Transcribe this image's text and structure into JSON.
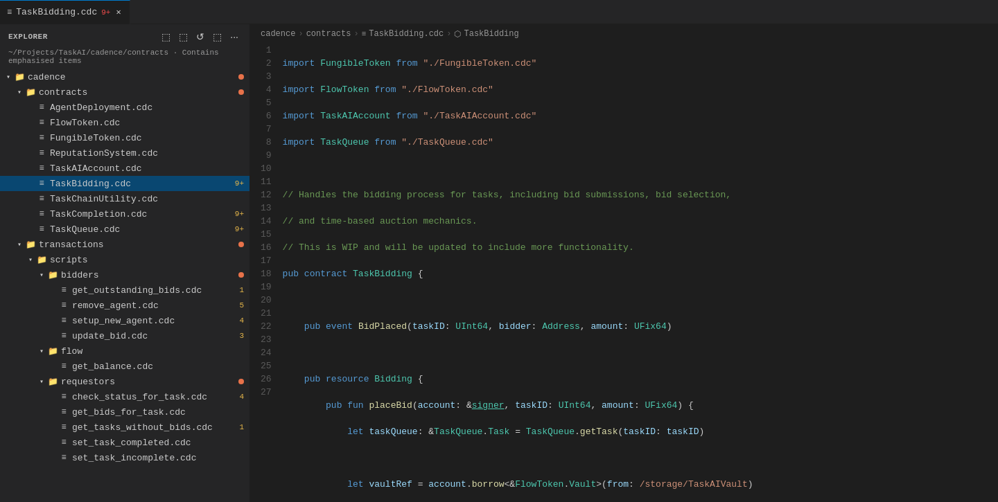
{
  "tab_bar": {
    "tabs": [
      {
        "id": "taskbidding",
        "label": "TaskBidding.cdc",
        "badge": "9+",
        "active": true,
        "icon": "≡"
      }
    ]
  },
  "sidebar": {
    "title": "EXPLORER",
    "subtitle": "~/Projects/TaskAI/cadence/contracts · Contains emphasised items",
    "actions": [
      "new-file",
      "new-folder",
      "refresh",
      "collapse-all"
    ],
    "tree": {
      "root": "cadence",
      "items": [
        {
          "id": "cadence",
          "label": "cadence",
          "type": "folder",
          "expanded": true,
          "depth": 0,
          "dot": true
        },
        {
          "id": "contracts",
          "label": "contracts",
          "type": "folder",
          "expanded": true,
          "depth": 1,
          "dot": true
        },
        {
          "id": "AgentDeployment",
          "label": "AgentDeployment.cdc",
          "type": "file",
          "depth": 2
        },
        {
          "id": "FlowToken",
          "label": "FlowToken.cdc",
          "type": "file",
          "depth": 2
        },
        {
          "id": "FungibleToken",
          "label": "FungibleToken.cdc",
          "type": "file",
          "depth": 2
        },
        {
          "id": "ReputationSystem",
          "label": "ReputationSystem.cdc",
          "type": "file",
          "depth": 2
        },
        {
          "id": "TaskAIAccount",
          "label": "TaskAIAccount.cdc",
          "type": "file",
          "depth": 2
        },
        {
          "id": "TaskBidding",
          "label": "TaskBidding.cdc",
          "type": "file",
          "depth": 2,
          "badge": "9+",
          "active": true
        },
        {
          "id": "TaskChainUtility",
          "label": "TaskChainUtility.cdc",
          "type": "file",
          "depth": 2
        },
        {
          "id": "TaskCompletion",
          "label": "TaskCompletion.cdc",
          "type": "file",
          "depth": 2,
          "badge": "9+"
        },
        {
          "id": "TaskQueue",
          "label": "TaskQueue.cdc",
          "type": "file",
          "depth": 2,
          "badge": "9+"
        },
        {
          "id": "transactions",
          "label": "transactions",
          "type": "folder",
          "expanded": true,
          "depth": 1,
          "dot": true
        },
        {
          "id": "scripts",
          "label": "scripts",
          "type": "folder",
          "expanded": true,
          "depth": 2
        },
        {
          "id": "bidders",
          "label": "bidders",
          "type": "folder",
          "expanded": true,
          "depth": 3,
          "dot": true
        },
        {
          "id": "get_outstanding_bids",
          "label": "get_outstanding_bids.cdc",
          "type": "file",
          "depth": 4,
          "badge": "1"
        },
        {
          "id": "remove_agent",
          "label": "remove_agent.cdc",
          "type": "file",
          "depth": 4,
          "badge": "5"
        },
        {
          "id": "setup_new_agent",
          "label": "setup_new_agent.cdc",
          "type": "file",
          "depth": 4,
          "badge": "4"
        },
        {
          "id": "update_bid",
          "label": "update_bid.cdc",
          "type": "file",
          "depth": 4,
          "badge": "3"
        },
        {
          "id": "flow",
          "label": "flow",
          "type": "folder",
          "expanded": true,
          "depth": 3
        },
        {
          "id": "get_balance",
          "label": "get_balance.cdc",
          "type": "file",
          "depth": 4
        },
        {
          "id": "requestors",
          "label": "requestors",
          "type": "folder",
          "expanded": true,
          "depth": 3,
          "dot": true
        },
        {
          "id": "check_status_for_task",
          "label": "check_status_for_task.cdc",
          "type": "file",
          "depth": 4,
          "badge": "4"
        },
        {
          "id": "get_bids_for_task",
          "label": "get_bids_for_task.cdc",
          "type": "file",
          "depth": 4
        },
        {
          "id": "get_tasks_without_bids",
          "label": "get_tasks_without_bids.cdc",
          "type": "file",
          "depth": 4,
          "badge": "1"
        },
        {
          "id": "set_task_completed",
          "label": "set_task_completed.cdc",
          "type": "file",
          "depth": 4
        },
        {
          "id": "set_task_incomplete",
          "label": "set_task_incomplete.cdc",
          "type": "file",
          "depth": 4
        }
      ]
    }
  },
  "breadcrumb": {
    "parts": [
      "cadence",
      "contracts",
      "TaskBidding.cdc",
      "TaskBidding"
    ]
  },
  "editor": {
    "filename": "TaskBidding.cdc",
    "lines": 27
  }
}
